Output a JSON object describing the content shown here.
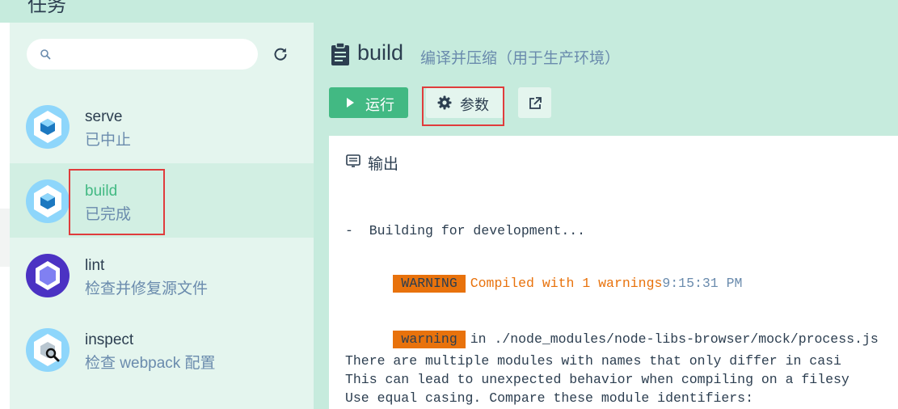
{
  "header": {
    "title": "任务"
  },
  "search": {
    "placeholder": "",
    "value": ""
  },
  "tasks": [
    {
      "name": "serve",
      "status": "已中止",
      "icon": "webpack-cube-icon"
    },
    {
      "name": "build",
      "status": "已完成",
      "icon": "webpack-cube-icon"
    },
    {
      "name": "lint",
      "status": "检查并修复源文件",
      "icon": "eslint-hexagon-icon"
    },
    {
      "name": "inspect",
      "status": "检查 webpack 配置",
      "icon": "webpack-inspect-icon"
    }
  ],
  "main": {
    "title": "build",
    "subtitle": "编译并压缩（用于生产环境）",
    "run_label": "运行",
    "params_label": "参数",
    "output_title": "输出"
  },
  "log": {
    "line1": "-  Building for development...",
    "warning_badge": "WARNING",
    "compiled_text": "Compiled with 1 warnings",
    "compiled_time": "9:15:31 PM",
    "warning_badge2": "warning",
    "warning_path": "in ./node_modules/node-libs-browser/mock/process.js",
    "line_a": "There are multiple modules with names that only differ in casi",
    "line_b": "This can lead to unexpected behavior when compiling on a filesy",
    "line_c": "Use equal casing. Compare these module identifiers:"
  },
  "colors": {
    "accent": "#42b983",
    "warning": "#e8720c",
    "highlight_box": "#e03c3c",
    "header_bg": "#c6ebdd",
    "sidebar_bg": "#e4f5ee"
  }
}
